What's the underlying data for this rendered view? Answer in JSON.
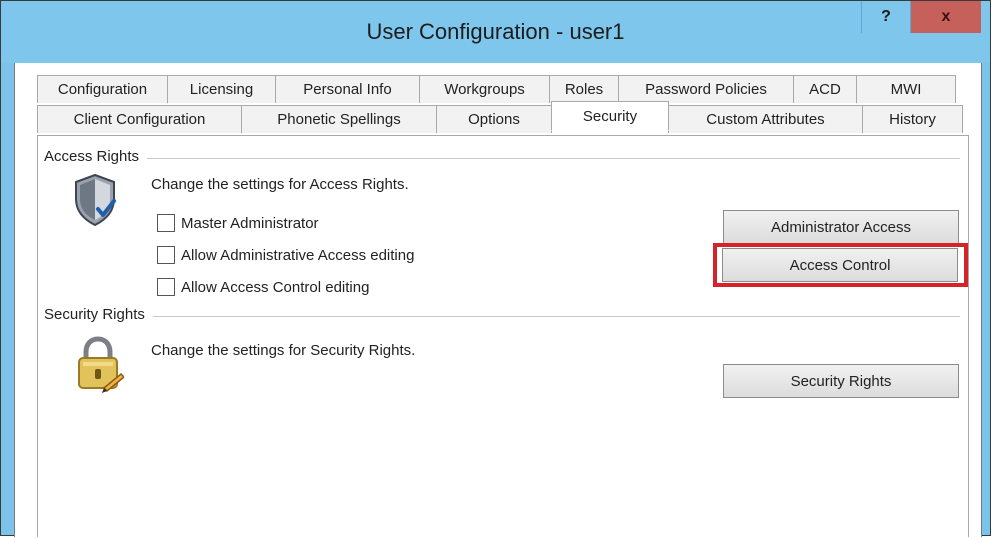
{
  "window": {
    "title": "User Configuration - user1",
    "help_label": "?",
    "close_label": "x"
  },
  "tabs": {
    "row1": [
      "Configuration",
      "Licensing",
      "Personal Info",
      "Workgroups",
      "Roles",
      "Password Policies",
      "ACD",
      "MWI"
    ],
    "row2": [
      "Client Configuration",
      "Phonetic Spellings",
      "Options",
      "Security",
      "Custom Attributes",
      "History"
    ],
    "active": "Security"
  },
  "access_rights": {
    "title": "Access Rights",
    "description": "Change the settings for Access Rights.",
    "icon": "shield-icon",
    "checkboxes": [
      {
        "label": "Master Administrator",
        "checked": false
      },
      {
        "label": "Allow Administrative Access editing",
        "checked": false
      },
      {
        "label": "Allow Access Control editing",
        "checked": false
      }
    ],
    "buttons": {
      "administrator_access": "Administrator Access",
      "access_control": "Access Control"
    }
  },
  "security_rights": {
    "title": "Security Rights",
    "description": "Change the settings for Security Rights.",
    "icon": "lock-icon",
    "button": "Security Rights"
  },
  "colors": {
    "titlebar": "#7fc6ec",
    "close_button": "#c5605a",
    "highlight": "#d4242a"
  }
}
